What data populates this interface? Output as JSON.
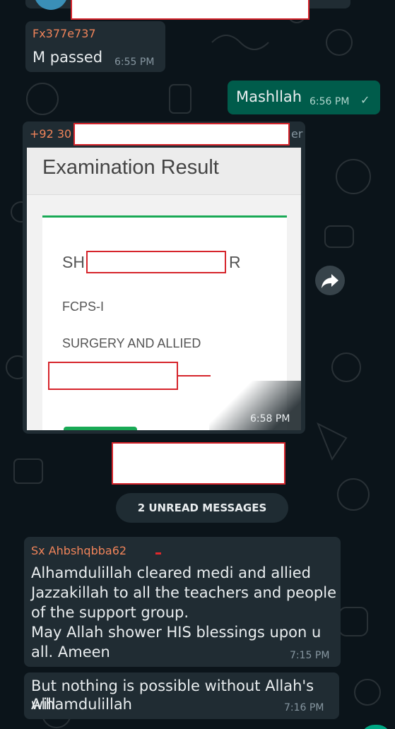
{
  "messages": {
    "m1": {
      "sender": "Fx377e737",
      "text": "M passed",
      "time": "6:55 PM"
    },
    "m2": {
      "text": "Mashllah",
      "time": "6:56 PM",
      "tick": "✓"
    },
    "m3": {
      "sender_prefix": "+92 30",
      "sender_suffix": "er",
      "card_title": "Examination Result",
      "name_start": "SH",
      "name_end": "R",
      "exam": "FCPS-I",
      "subject": "SURGERY AND ALLIED",
      "time": "6:58 PM"
    },
    "unread": "2 UNREAD MESSAGES",
    "m4": {
      "sender": "Sx Ahbshqbba62",
      "lines": [
        "Alhamdulillah cleared medi and allied",
        "Jazzakillah to all the teachers and people",
        "of the support group.",
        "May Allah shower HIS blessings upon u",
        "all. Ameen"
      ],
      "time": "7:15 PM"
    },
    "m5": {
      "lines": [
        "But nothing is possible without Allah's will",
        "Alhamdulillah"
      ],
      "time": "7:16 PM"
    }
  },
  "icons": {
    "forward": "forward-arrow-icon",
    "read_status": "check-icon"
  },
  "colors": {
    "background": "#0b141a",
    "incoming": "#202c33",
    "outgoing": "#005c4b",
    "sender1": "#f0845a",
    "sender2": "#f0845a",
    "redaction_border": "#d6242b",
    "result_accent": "#19a955"
  }
}
